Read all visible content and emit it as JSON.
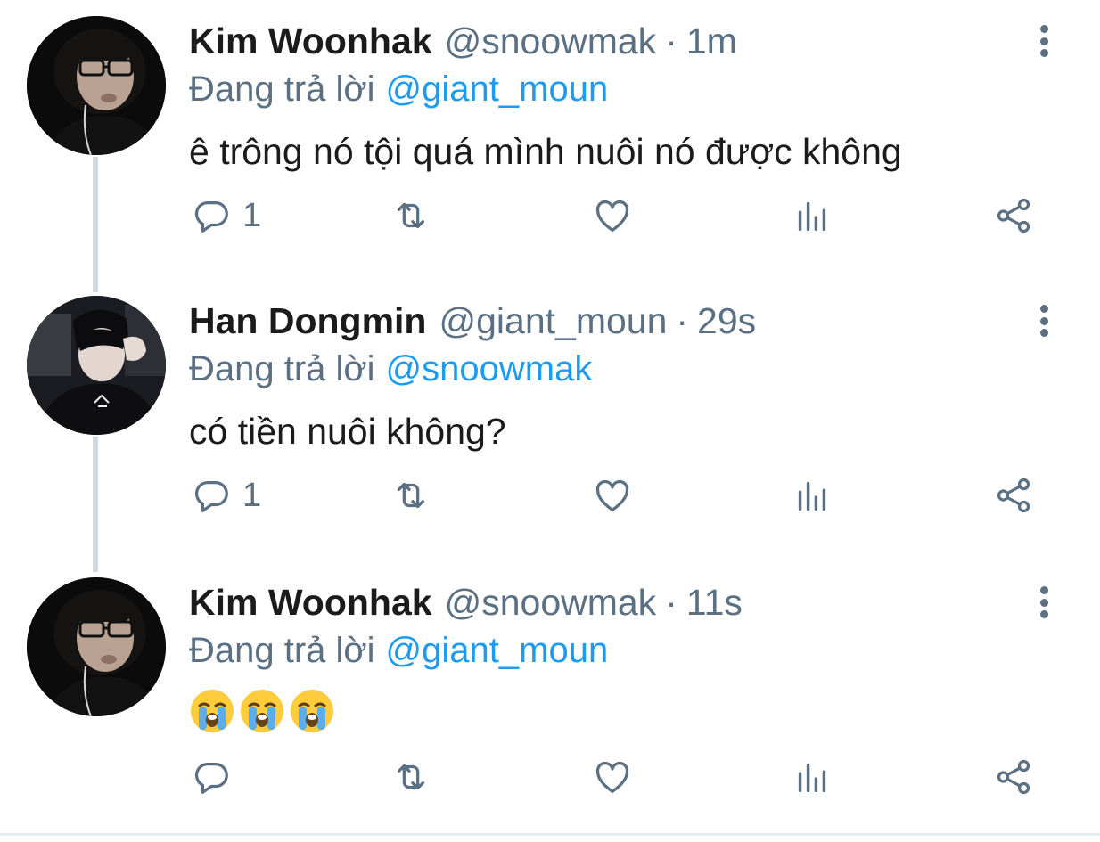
{
  "tweets": [
    {
      "name": "Kim Woonhak",
      "handle": "@snoowmak",
      "separator": "·",
      "time": "1m",
      "replying_label": "Đang trả lời",
      "replying_to": "@giant_moun",
      "text": "ê trông nó tội quá mình nuôi nó được không",
      "reply_count": "1"
    },
    {
      "name": "Han Dongmin",
      "handle": "@giant_moun",
      "separator": "·",
      "time": "29s",
      "replying_label": "Đang trả lời",
      "replying_to": "@snoowmak",
      "text": "có tiền nuôi không?",
      "reply_count": "1"
    },
    {
      "name": "Kim Woonhak",
      "handle": "@snoowmak",
      "separator": "·",
      "time": "11s",
      "replying_label": "Đang trả lời",
      "replying_to": "@giant_moun",
      "emojis": [
        "loudly-crying-face-emoji",
        "loudly-crying-face-emoji",
        "loudly-crying-face-emoji"
      ],
      "reply_count": ""
    }
  ],
  "icons": {
    "reply": "reply-icon",
    "retweet": "retweet-icon",
    "like": "like-icon",
    "analytics": "analytics-icon",
    "share": "share-icon",
    "more": "more-options-icon"
  },
  "colors": {
    "link": "#1d9bf0",
    "muted": "#5b7083",
    "thread_line": "#cfd9de"
  }
}
